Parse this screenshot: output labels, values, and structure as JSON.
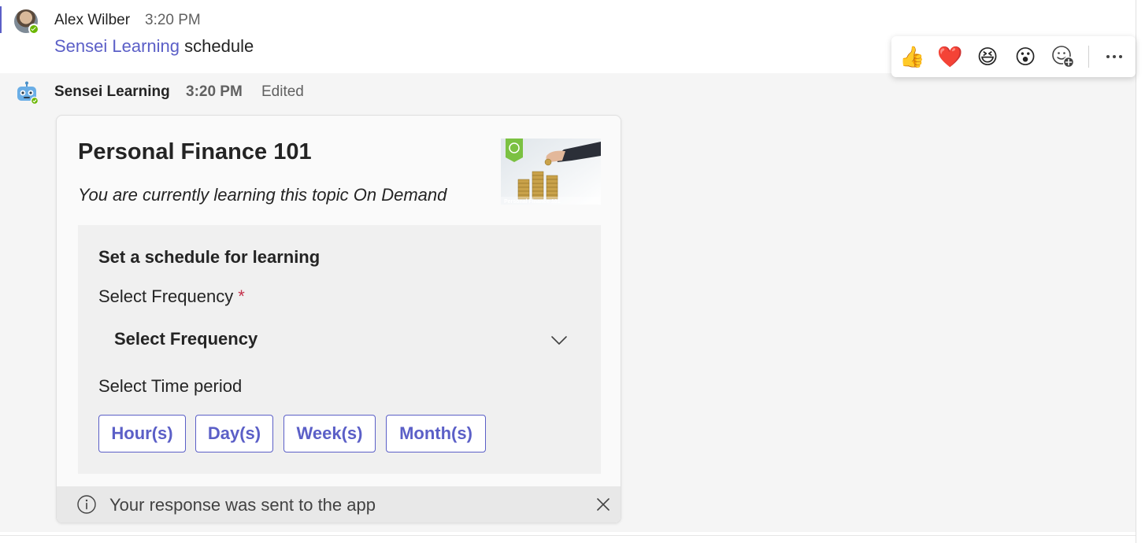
{
  "user_message": {
    "author": "Alex Wilber",
    "time": "3:20 PM",
    "link_text": "Sensei Learning",
    "text": "schedule"
  },
  "reactions": {
    "items": [
      "thumbs-up",
      "heart",
      "laugh",
      "surprised",
      "add-reaction"
    ],
    "more": "more-options"
  },
  "bot_message": {
    "author": "Sensei Learning",
    "time": "3:20 PM",
    "edited_label": "Edited"
  },
  "card": {
    "title": "Personal Finance 101",
    "subtitle": "You are currently learning this topic On Demand",
    "image_caption": "Personal Finance 101",
    "schedule": {
      "heading": "Set a schedule for learning",
      "frequency_label": "Select Frequency",
      "required_marker": "*",
      "frequency_value": "Select Frequency",
      "time_period_label": "Select Time period",
      "period_buttons": [
        "Hour(s)",
        "Day(s)",
        "Week(s)",
        "Month(s)"
      ]
    },
    "status": {
      "text": "Your response was sent to the app"
    }
  },
  "colors": {
    "accent": "#5b5fc7",
    "required": "#c4314b",
    "presence": "#6bb700"
  }
}
